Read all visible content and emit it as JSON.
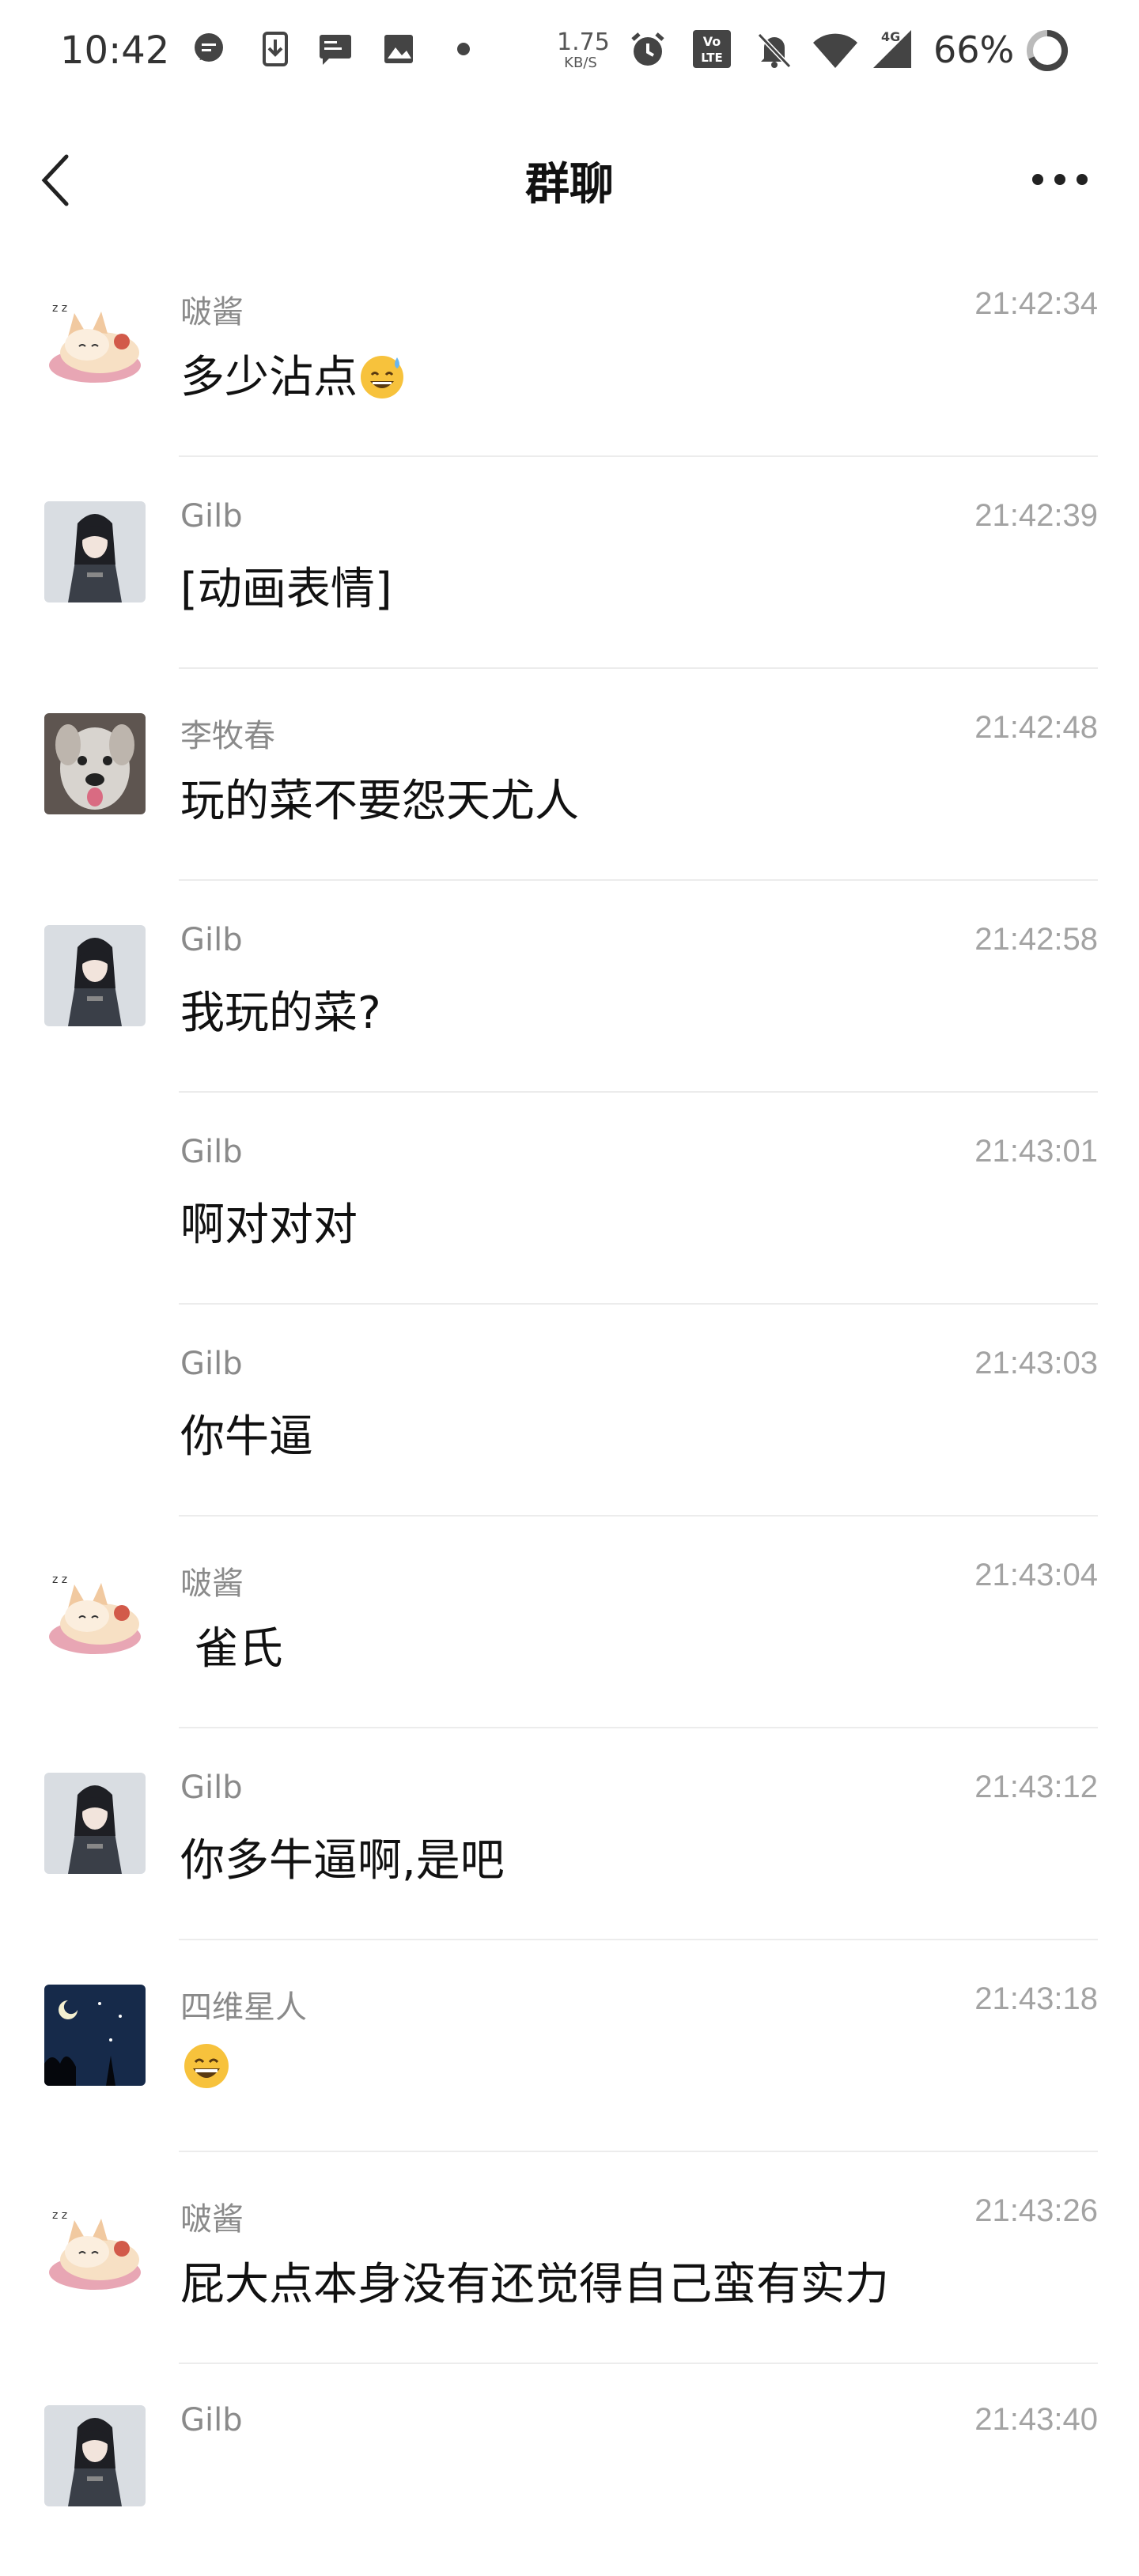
{
  "status_bar": {
    "time": "10:42",
    "network_speed_value": "1.75",
    "network_speed_unit": "KB/S",
    "battery": "66%",
    "icons": [
      "chat-notification-icon",
      "download-icon",
      "message-icon",
      "image-icon",
      "dot-icon",
      "alarm-icon",
      "volte-icon",
      "mute-icon",
      "wifi-icon",
      "signal-4g-icon",
      "battery-ring-icon"
    ]
  },
  "nav": {
    "title": "群聊",
    "back_icon": "chevron-left-icon",
    "more_icon": "more-dots-icon"
  },
  "messages": [
    {
      "sender": "啵酱",
      "time": "21:42:34",
      "text": "多少沾点",
      "emoji": "sweat-smile-emoji",
      "avatar": "fox-avatar"
    },
    {
      "sender": "Gilb",
      "time": "21:42:39",
      "text": "[动画表情]",
      "avatar": "swordsman-avatar"
    },
    {
      "sender": "李牧春",
      "time": "21:42:48",
      "text": "玩的菜不要怨天尤人",
      "avatar": "dog-avatar"
    },
    {
      "sender": "Gilb",
      "time": "21:42:58",
      "text": "我玩的菜?",
      "avatar": "swordsman-avatar"
    },
    {
      "sender": "Gilb",
      "time": "21:43:01",
      "text": "啊对对对",
      "avatar": ""
    },
    {
      "sender": "Gilb",
      "time": "21:43:03",
      "text": "你牛逼",
      "avatar": ""
    },
    {
      "sender": "啵酱",
      "time": "21:43:04",
      "text": " 雀氏",
      "avatar": "fox-avatar"
    },
    {
      "sender": "Gilb",
      "time": "21:43:12",
      "text": "你多牛逼啊,是吧",
      "avatar": "swordsman-avatar"
    },
    {
      "sender": "四维星人",
      "time": "21:43:18",
      "text": "",
      "emoji": "grin-emoji",
      "avatar": "night-sky-avatar"
    },
    {
      "sender": "啵酱",
      "time": "21:43:26",
      "text": "屁大点本身没有还觉得自己蛮有实力",
      "avatar": "fox-avatar"
    },
    {
      "sender": "Gilb",
      "time": "21:43:40",
      "text": "",
      "avatar": "swordsman-avatar"
    }
  ],
  "colors": {
    "sender": "#8a8a8a",
    "time": "#a3a3a3",
    "divider": "#ececec",
    "text": "#111111"
  }
}
